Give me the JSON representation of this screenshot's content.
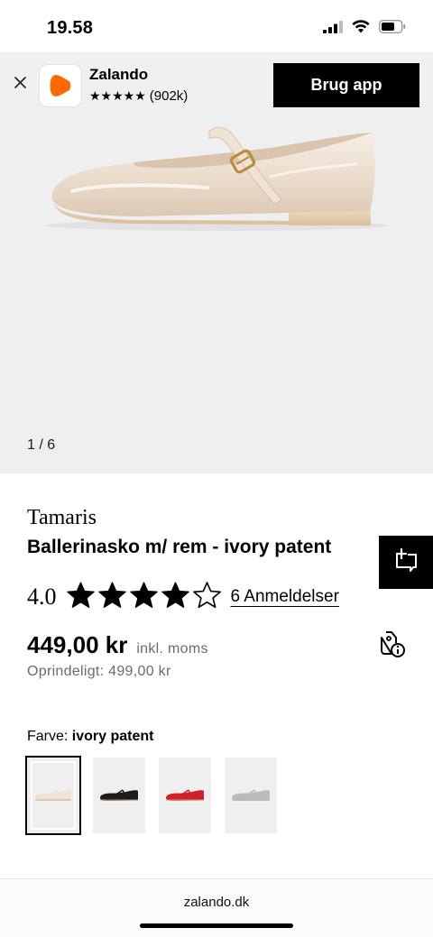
{
  "status_bar": {
    "time": "19.58"
  },
  "app_banner": {
    "app_name": "Zalando",
    "stars": "★★★★★",
    "review_count": "(902k)",
    "cta_label": "Brug app"
  },
  "gallery": {
    "counter": "1 / 6"
  },
  "product": {
    "brand": "Tamaris",
    "name": "Ballerinasko m/ rem - ivory patent",
    "rating": "4.0",
    "rating_stars": 4,
    "rating_max": 5,
    "reviews_label": "6 Anmeldelser",
    "price": "449,00 kr",
    "vat_note": "inkl. moms",
    "original_price": "Oprindeligt: 499,00 kr",
    "color_label": "Farve:",
    "color_value": "ivory patent"
  },
  "swatches": [
    {
      "color": "ivory",
      "hex": "#efe3d6",
      "selected": true
    },
    {
      "color": "black",
      "hex": "#1b1b1b",
      "selected": false
    },
    {
      "color": "red",
      "hex": "#d2202a",
      "selected": false
    },
    {
      "color": "silver",
      "hex": "#b9bcbc",
      "selected": false
    }
  ],
  "browser": {
    "url": "zalando.dk"
  },
  "colors": {
    "brand_orange": "#ff6900",
    "banner_bg": "#eff0f1",
    "image_bg": "#efefef"
  }
}
